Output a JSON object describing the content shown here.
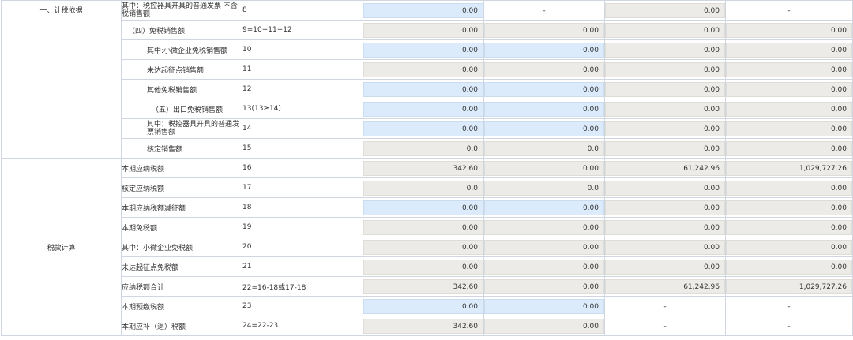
{
  "sections": {
    "s1": "一、计税依据",
    "s2": "税款计算"
  },
  "rows": [
    {
      "item": "其中：税控器具开具的普通发票 不含税销售额",
      "seq": "8",
      "v": [
        {
          "t": "0.00",
          "s": "blue"
        },
        {
          "t": "-",
          "s": "dash"
        },
        {
          "t": "0.00",
          "s": "gray"
        },
        {
          "t": "-",
          "s": "dash"
        }
      ]
    },
    {
      "item": "（四）免税销售额",
      "seq": "9=10+11+12",
      "v": [
        {
          "t": "0.00",
          "s": "gray"
        },
        {
          "t": "0.00",
          "s": "gray"
        },
        {
          "t": "0.00",
          "s": "gray"
        },
        {
          "t": "0.00",
          "s": "gray"
        }
      ]
    },
    {
      "item": "其中:小微企业免税销售额",
      "seq": "10",
      "v": [
        {
          "t": "0.00",
          "s": "blue"
        },
        {
          "t": "0.00",
          "s": "blue"
        },
        {
          "t": "0.00",
          "s": "gray"
        },
        {
          "t": "0.00",
          "s": "gray"
        }
      ]
    },
    {
      "item": "未达起征点销售额",
      "seq": "11",
      "v": [
        {
          "t": "0.00",
          "s": "gray"
        },
        {
          "t": "0.00",
          "s": "gray"
        },
        {
          "t": "0.00",
          "s": "gray"
        },
        {
          "t": "0.00",
          "s": "gray"
        }
      ]
    },
    {
      "item": "其他免税销售额",
      "seq": "12",
      "v": [
        {
          "t": "0.00",
          "s": "blue"
        },
        {
          "t": "0.00",
          "s": "blue"
        },
        {
          "t": "0.00",
          "s": "gray"
        },
        {
          "t": "0.00",
          "s": "gray"
        }
      ]
    },
    {
      "item": "（五）出口免税销售额",
      "seq": "13(13≥14)",
      "v": [
        {
          "t": "0.00",
          "s": "blue"
        },
        {
          "t": "0.00",
          "s": "blue"
        },
        {
          "t": "0.00",
          "s": "gray"
        },
        {
          "t": "0.00",
          "s": "gray"
        }
      ]
    },
    {
      "item": "其中：税控器具开具的普通发票销售额",
      "seq": "14",
      "v": [
        {
          "t": "0.00",
          "s": "blue"
        },
        {
          "t": "0.00",
          "s": "blue"
        },
        {
          "t": "0.00",
          "s": "gray"
        },
        {
          "t": "0.00",
          "s": "gray"
        }
      ]
    },
    {
      "item": "核定销售额",
      "seq": "15",
      "v": [
        {
          "t": "0.0",
          "s": "gray"
        },
        {
          "t": "0.0",
          "s": "gray"
        },
        {
          "t": "0.00",
          "s": "gray"
        },
        {
          "t": "0.00",
          "s": "gray"
        }
      ]
    },
    {
      "item": "本期应纳税额",
      "seq": "16",
      "v": [
        {
          "t": "342.60",
          "s": "gray"
        },
        {
          "t": "0.00",
          "s": "gray"
        },
        {
          "t": "61,242.96",
          "s": "gray"
        },
        {
          "t": "1,029,727.26",
          "s": "gray"
        }
      ]
    },
    {
      "item": "核定应纳税额",
      "seq": "17",
      "v": [
        {
          "t": "0.0",
          "s": "gray"
        },
        {
          "t": "0.0",
          "s": "gray"
        },
        {
          "t": "0.00",
          "s": "gray"
        },
        {
          "t": "0.00",
          "s": "gray"
        }
      ]
    },
    {
      "item": "本期应纳税额减征额",
      "seq": "18",
      "v": [
        {
          "t": "0.00",
          "s": "blue"
        },
        {
          "t": "0.00",
          "s": "blue"
        },
        {
          "t": "0.00",
          "s": "gray"
        },
        {
          "t": "0.00",
          "s": "gray"
        }
      ]
    },
    {
      "item": "本期免税额",
      "seq": "19",
      "v": [
        {
          "t": "0.00",
          "s": "gray"
        },
        {
          "t": "0.00",
          "s": "gray"
        },
        {
          "t": "0.00",
          "s": "gray"
        },
        {
          "t": "0.00",
          "s": "gray"
        }
      ]
    },
    {
      "item": "其中：小微企业免税额",
      "seq": "20",
      "v": [
        {
          "t": "0.00",
          "s": "gray"
        },
        {
          "t": "0.00",
          "s": "gray"
        },
        {
          "t": "0.00",
          "s": "gray"
        },
        {
          "t": "0.00",
          "s": "gray"
        }
      ]
    },
    {
      "item": "未达起征点免税额",
      "seq": "21",
      "v": [
        {
          "t": "0.00",
          "s": "gray"
        },
        {
          "t": "0.00",
          "s": "gray"
        },
        {
          "t": "0.00",
          "s": "gray"
        },
        {
          "t": "0.00",
          "s": "gray"
        }
      ]
    },
    {
      "item": "应纳税额合计",
      "seq": "22=16-18或17-18",
      "v": [
        {
          "t": "342.60",
          "s": "gray"
        },
        {
          "t": "0.00",
          "s": "gray"
        },
        {
          "t": "61,242.96",
          "s": "gray"
        },
        {
          "t": "1,029,727.26",
          "s": "gray"
        }
      ]
    },
    {
      "item": "本期预缴税额",
      "seq": "23",
      "v": [
        {
          "t": "0.00",
          "s": "blue"
        },
        {
          "t": "0.00",
          "s": "blue"
        },
        {
          "t": "-",
          "s": "dash"
        },
        {
          "t": "-",
          "s": "dash"
        }
      ]
    },
    {
      "item": "本期应补（退）税额",
      "seq": "24=22-23",
      "v": [
        {
          "t": "342.60",
          "s": "gray"
        },
        {
          "t": "0.00",
          "s": "gray"
        },
        {
          "t": "-",
          "s": "dash"
        },
        {
          "t": "-",
          "s": "dash"
        }
      ]
    }
  ],
  "colors": {
    "editable_blue": "#dcebfb",
    "readonly_gray": "#ecebe7",
    "border": "#cfd6df"
  }
}
